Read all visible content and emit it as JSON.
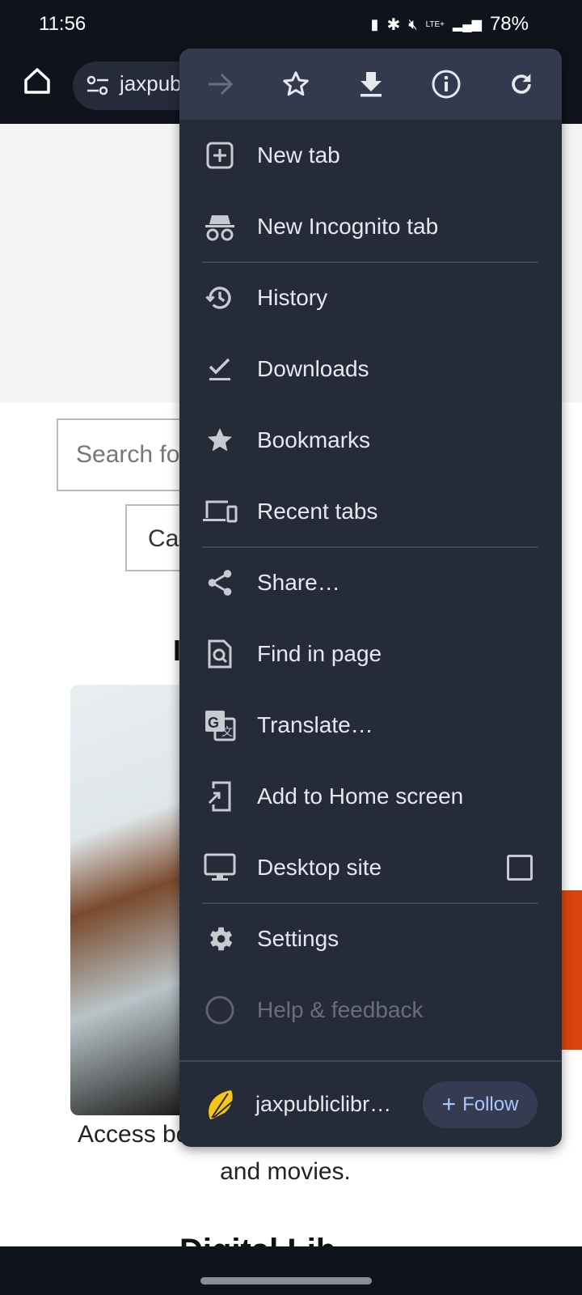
{
  "status_bar": {
    "time": "11:56",
    "battery": "78%",
    "network": "LTE+"
  },
  "browser": {
    "url": "jaxpubl"
  },
  "page": {
    "search_placeholder": "Search fo",
    "category_button": "Ca",
    "heading": "I",
    "caption_line1": "Access bo",
    "caption_line2": "and movies.",
    "heading2": "Digital Lib"
  },
  "menu": {
    "top_icons": [
      {
        "name": "forward-icon",
        "enabled": false
      },
      {
        "name": "bookmark-star-icon",
        "enabled": true
      },
      {
        "name": "download-icon",
        "enabled": true
      },
      {
        "name": "page-info-icon",
        "enabled": true
      },
      {
        "name": "reload-icon",
        "enabled": true
      }
    ],
    "items": [
      {
        "label": "New tab",
        "icon": "new-tab-icon"
      },
      {
        "label": "New Incognito tab",
        "icon": "incognito-icon"
      },
      {
        "label": "History",
        "icon": "history-icon"
      },
      {
        "label": "Downloads",
        "icon": "downloads-icon"
      },
      {
        "label": "Bookmarks",
        "icon": "bookmarks-icon"
      },
      {
        "label": "Recent tabs",
        "icon": "recent-tabs-icon"
      },
      {
        "label": "Share…",
        "icon": "share-icon"
      },
      {
        "label": "Find in page",
        "icon": "find-in-page-icon"
      },
      {
        "label": "Translate…",
        "icon": "translate-icon"
      },
      {
        "label": "Add to Home screen",
        "icon": "add-to-home-icon"
      },
      {
        "label": "Desktop site",
        "icon": "desktop-icon",
        "checked": false
      },
      {
        "label": "Settings",
        "icon": "settings-icon"
      },
      {
        "label": "Help & feedback",
        "icon": "help-icon"
      }
    ],
    "footer": {
      "site": "jaxpubliclibr…",
      "follow_label": "Follow"
    }
  },
  "colors": {
    "menu_bg": "#262b3a",
    "menu_top": "#333a4d",
    "follow_text": "#a8c7fa",
    "logo": "#f5c518"
  }
}
